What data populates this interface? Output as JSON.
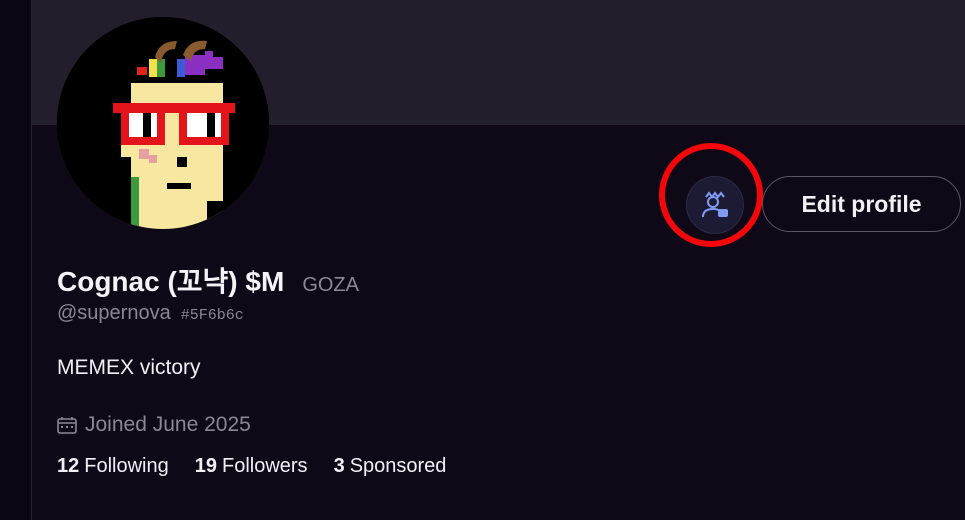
{
  "profile": {
    "display_name": "Cognac (꼬냑) $M",
    "tag": "GOZA",
    "handle": "@supernova",
    "hash_code": "#5F6b6c",
    "bio": "MEMEX victory",
    "joined": "Joined June 2025"
  },
  "actions": {
    "edit_profile_label": "Edit profile",
    "subscription_icon": "user-crown-icon"
  },
  "stats": [
    {
      "count": "12",
      "label": "Following"
    },
    {
      "count": "19",
      "label": "Followers"
    },
    {
      "count": "3",
      "label": "Sponsored"
    }
  ],
  "colors": {
    "page_bg": "#0f0817",
    "banner_bg": "#231e2c",
    "highlight_ring": "#f3070a",
    "icon_accent": "#7f9cf5"
  }
}
